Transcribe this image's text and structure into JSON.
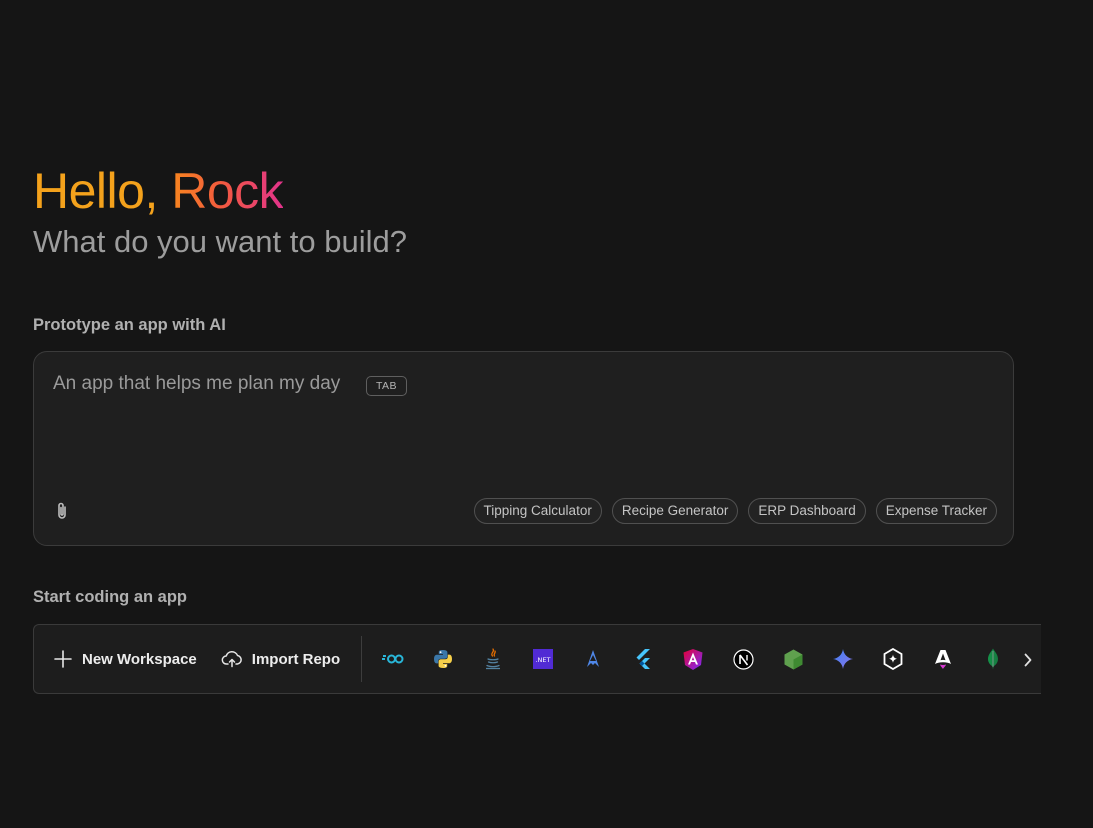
{
  "greeting": {
    "hello": "Hello,",
    "name": "Rock"
  },
  "subtitle": "What do you want to build?",
  "prototype": {
    "label": "Prototype an app with AI",
    "placeholder": "An app that helps me plan my day",
    "tab_hint": "TAB",
    "attach_icon": "paperclip-icon",
    "suggestions": [
      "Tipping Calculator",
      "Recipe Generator",
      "ERP Dashboard",
      "Expense Tracker"
    ]
  },
  "coding": {
    "label": "Start coding an app",
    "new_workspace": "New Workspace",
    "import_repo": "Import Repo",
    "templates": [
      {
        "icon": "go-icon",
        "color": "#29b6d8"
      },
      {
        "icon": "python-icon",
        "color": "#3b77a8"
      },
      {
        "icon": "java-icon",
        "color": "#e76f00"
      },
      {
        "icon": "dotnet-icon",
        "color": "#512bd4",
        "text": ".NET"
      },
      {
        "icon": "astro-icon",
        "color": "#4f87e8"
      },
      {
        "icon": "flutter-icon",
        "color": "#47c5fb"
      },
      {
        "icon": "angular-icon",
        "color": "#dd1b5a"
      },
      {
        "icon": "nextjs-icon",
        "color": "#ffffff"
      },
      {
        "icon": "nodejs-icon",
        "color": "#5fa04e"
      },
      {
        "icon": "gemini-icon",
        "color": "#4f8df5"
      },
      {
        "icon": "genkit-icon",
        "color": "#ffffff"
      },
      {
        "icon": "astro-a-icon",
        "color": "#ffffff"
      },
      {
        "icon": "mongodb-icon",
        "color": "#13aa52"
      }
    ],
    "next_icon": "chevron-right-icon"
  }
}
